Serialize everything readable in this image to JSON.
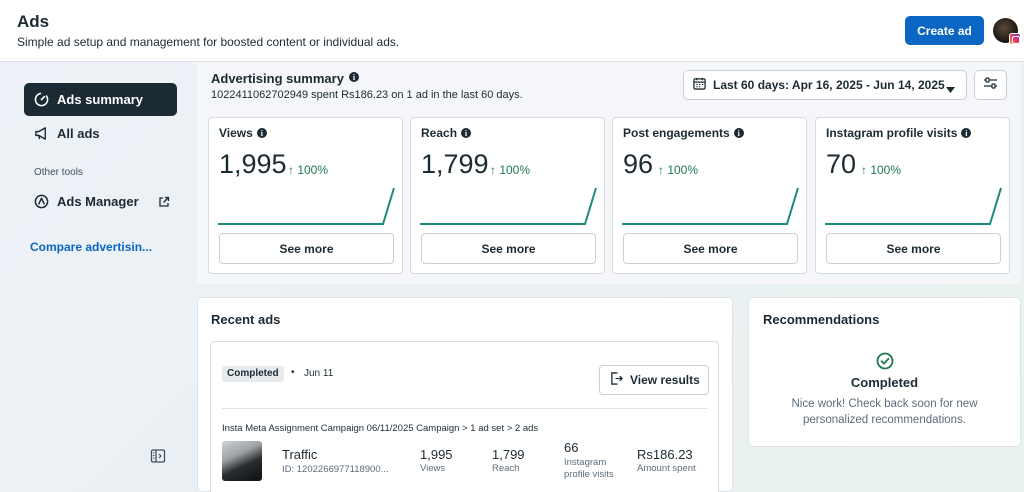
{
  "header": {
    "title": "Ads",
    "subtitle": "Simple ad setup and management for boosted content or individual ads.",
    "create_button": "Create ad"
  },
  "sidebar": {
    "items": [
      {
        "label": "Ads summary",
        "icon": "speedometer-icon",
        "active": true
      },
      {
        "label": "All ads",
        "icon": "megaphone-icon",
        "active": false
      }
    ],
    "section_label": "Other tools",
    "tools": [
      {
        "label": "Ads Manager",
        "icon": "ads-manager-icon",
        "external": true
      }
    ],
    "compare_link": "Compare advertisin..."
  },
  "summary": {
    "title": "Advertising summary",
    "subtitle": "1022411062702949 spent Rs186.23 on 1 ad in the last 60 days.",
    "date_range": "Last 60 days: Apr 16, 2025 - Jun 14, 2025",
    "see_more_label": "See more",
    "metrics": [
      {
        "label": "Views",
        "value": "1,995",
        "change": "↑ 100%"
      },
      {
        "label": "Reach",
        "value": "1,799",
        "change": "↑ 100%"
      },
      {
        "label": "Post engagements",
        "value": "96",
        "change": "↑ 100%"
      },
      {
        "label": "Instagram profile visits",
        "value": "70",
        "change": "↑ 100%"
      }
    ]
  },
  "recent_ads": {
    "title": "Recent ads",
    "ad": {
      "status": "Completed",
      "separator": "•",
      "date": "Jun 11",
      "view_results": "View results",
      "campaign_path": "Insta Meta Assignment Campaign 06/11/2025 Campaign > 1 ad set > 2 ads",
      "type": "Traffic",
      "id": "ID: 1202266977118900...",
      "stats": [
        {
          "value": "1,995",
          "label": "Views"
        },
        {
          "value": "1,799",
          "label": "Reach"
        },
        {
          "value": "66",
          "label": "Instagram profile visits"
        },
        {
          "value": "Rs186.23",
          "label": "Amount spent"
        }
      ]
    }
  },
  "recommendations": {
    "title": "Recommendations",
    "status": "Completed",
    "message": "Nice work! Check back soon for new personalized recommendations."
  },
  "colors": {
    "primary": "#0a66c2",
    "dark": "#1c2b33",
    "positive": "#1f7a4f",
    "spark": "#1a8a7a"
  }
}
